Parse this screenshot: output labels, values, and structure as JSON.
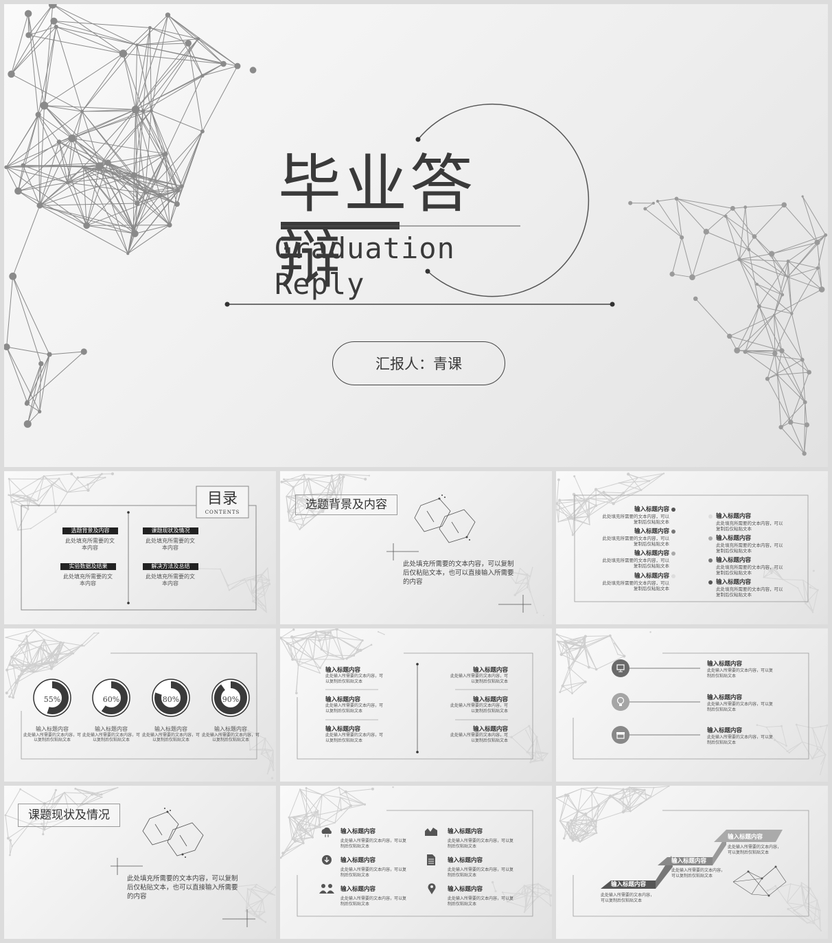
{
  "cover": {
    "title": "毕业答辩",
    "subtitle": "Graduation Reply",
    "reporter": "汇报人：青课"
  },
  "contents": {
    "title": "目录",
    "subtitle": "CONTENTS",
    "items": [
      {
        "tag": "选题背景及内容",
        "text": "此处填充所需要的文\n本内容"
      },
      {
        "tag": "课题现状及情况",
        "text": "此处填充所需要的文\n本内容"
      },
      {
        "tag": "实验数据及结果",
        "text": "此处填充所需要的文\n本内容"
      },
      {
        "tag": "解决方法及总结",
        "text": "此处填充所需要的文\n本内容"
      }
    ]
  },
  "background": {
    "title": "选题背景及内容",
    "text": "此处填充所需要的文本内容，可以复制\n后仅粘贴文本，也可以直接输入所需要\n的内容"
  },
  "list_slide": {
    "heading": "输入标题内容",
    "left_text": "此处填充所需要的文本内容，可以\n复制后仅粘贴文本",
    "right_text": "此处填充所需要的文本内容，可以\n复制后仅粘贴文本"
  },
  "rings": {
    "items": [
      {
        "pct": "55%",
        "value": 0.55
      },
      {
        "pct": "60%",
        "value": 0.6
      },
      {
        "pct": "80%",
        "value": 0.8
      },
      {
        "pct": "90%",
        "value": 0.9
      }
    ],
    "heading": "输入标题内容",
    "text": "此处输入所需要的文本内容，可\n以复制后仅粘贴文本"
  },
  "columns": {
    "heading": "输入标题内容",
    "text": "此处输入所需要的文本内容，可\n以复制后仅粘贴文本"
  },
  "icons_slide": {
    "heading": "输入标题内容",
    "text": "此处输入所需要的文本内容，可以复\n制后仅粘贴文本",
    "icons": [
      "monitor-icon",
      "lightbulb-icon",
      "shop-icon"
    ]
  },
  "status": {
    "title": "课题现状及情况",
    "text": "此处填充所需要的文本内容，可以复制\n后仅粘贴文本，也可以直接输入所需要\n的内容"
  },
  "grid6": {
    "heading": "输入标题内容",
    "text": "此处输入所需要的文本内容，可以复\n制后仅粘贴文本",
    "icons": [
      "cloud-icon",
      "area-chart-icon",
      "download-icon",
      "document-icon",
      "people-icon",
      "location-pin-icon"
    ]
  },
  "steps": {
    "heading": "输入标题内容",
    "text_a": "此处输入所需要的文本内容，\n可以复制后仅粘贴文本",
    "text_b": "此处输入所需要的文本内容，\n可以复制后仅粘贴文本"
  },
  "colors": {
    "dark": "#3a3a3a",
    "mid": "#888888",
    "light": "#d0d0d0"
  }
}
